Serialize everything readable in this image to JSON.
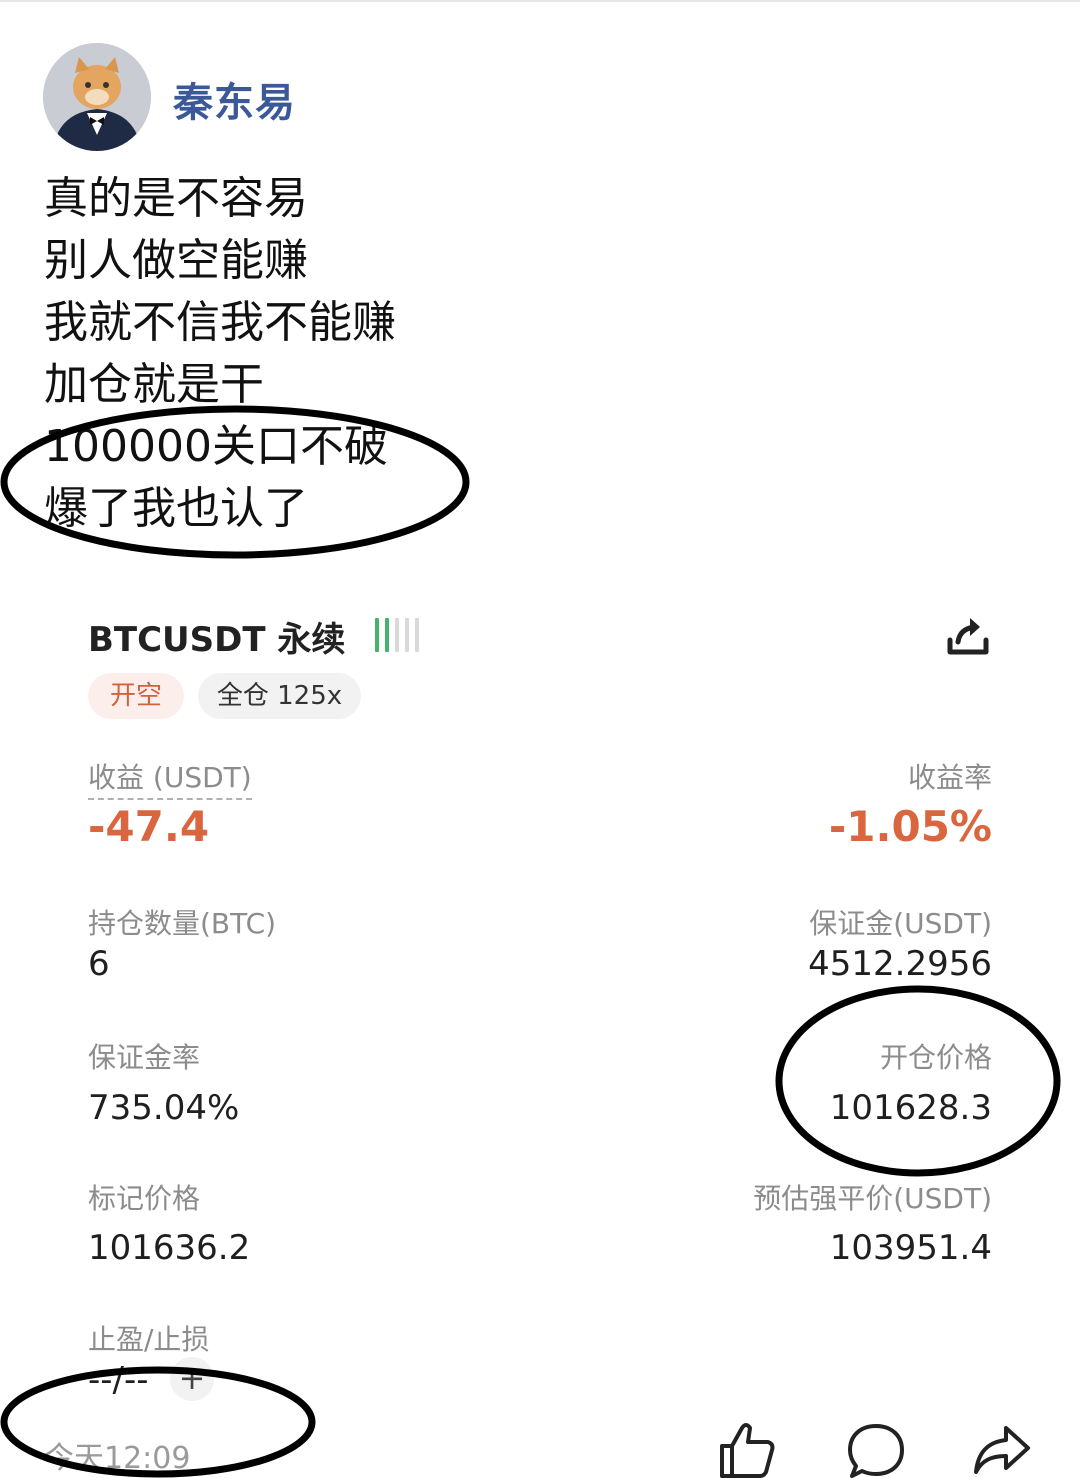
{
  "user": {
    "name": "秦东易",
    "avatar": "cat-in-tuxedo-avatar"
  },
  "post": {
    "lines": [
      "真的是不容易",
      "别人做空能赚",
      "我就不信我不能赚",
      "加仓就是干",
      "100000关口不破",
      "爆了我也认了"
    ]
  },
  "card": {
    "symbol": "BTCUSDT 永续",
    "tags": {
      "direction": "开空",
      "margin_mode": "全仓 125x"
    },
    "pnl": {
      "label": "收益 (USDT)",
      "value": "-47.4"
    },
    "pnl_rate": {
      "label": "收益率",
      "value": "-1.05%"
    },
    "position_size": {
      "label": "持仓数量(BTC)",
      "value": "6"
    },
    "margin": {
      "label": "保证金(USDT)",
      "value": "4512.2956"
    },
    "margin_ratio": {
      "label": "保证金率",
      "value": "735.04%"
    },
    "entry_price": {
      "label": "开仓价格",
      "value": "101628.3"
    },
    "mark_price": {
      "label": "标记价格",
      "value": "101636.2"
    },
    "liq_price": {
      "label": "预估强平价(USDT)",
      "value": "103951.4"
    },
    "tpsl": {
      "label": "止盈/止损",
      "value": "--/--",
      "add": "+"
    },
    "colors": {
      "loss": "#d9663f",
      "tag_bg": "#fcefeb"
    }
  },
  "footer": {
    "time": "今天12:09",
    "icons": [
      "thumbs-up-icon",
      "comment-icon",
      "share-icon"
    ]
  }
}
